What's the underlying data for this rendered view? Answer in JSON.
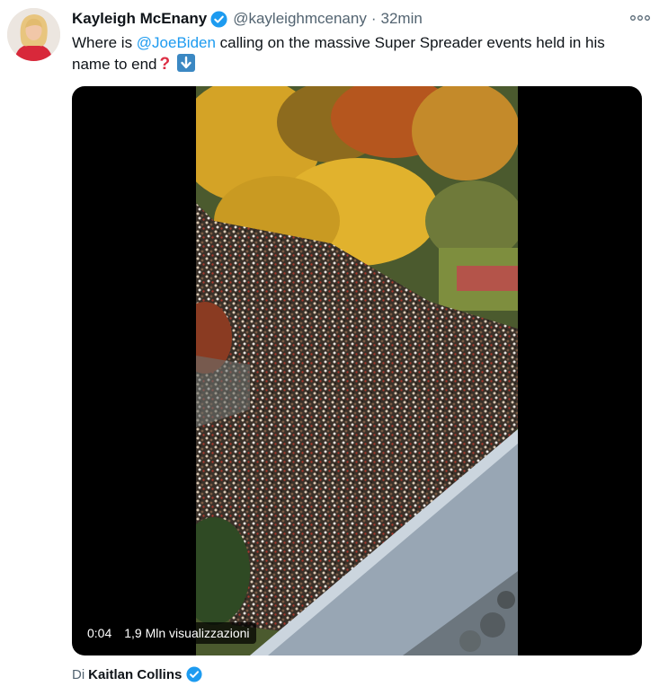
{
  "tweet": {
    "author_name": "Kayleigh McEnany",
    "author_handle": "@kayleighmcenany",
    "separator": "·",
    "timestamp": "32min",
    "more_icon": "more-options-icon",
    "text_before_mention": "Where is ",
    "mention": "@JoeBiden",
    "text_after_mention": " calling on the massive Super Spreader events held in his name to end",
    "emojis": [
      "red-question-mark-icon",
      "down-arrow-icon"
    ]
  },
  "video": {
    "elapsed": "0:04",
    "views": "1,9 Mln visualizzazioni"
  },
  "attribution": {
    "prefix": "Di",
    "name": "Kaitlan Collins"
  },
  "colors": {
    "link": "#1d9bf0",
    "verified": "#1d9bf0",
    "secondary_text": "#536471"
  }
}
